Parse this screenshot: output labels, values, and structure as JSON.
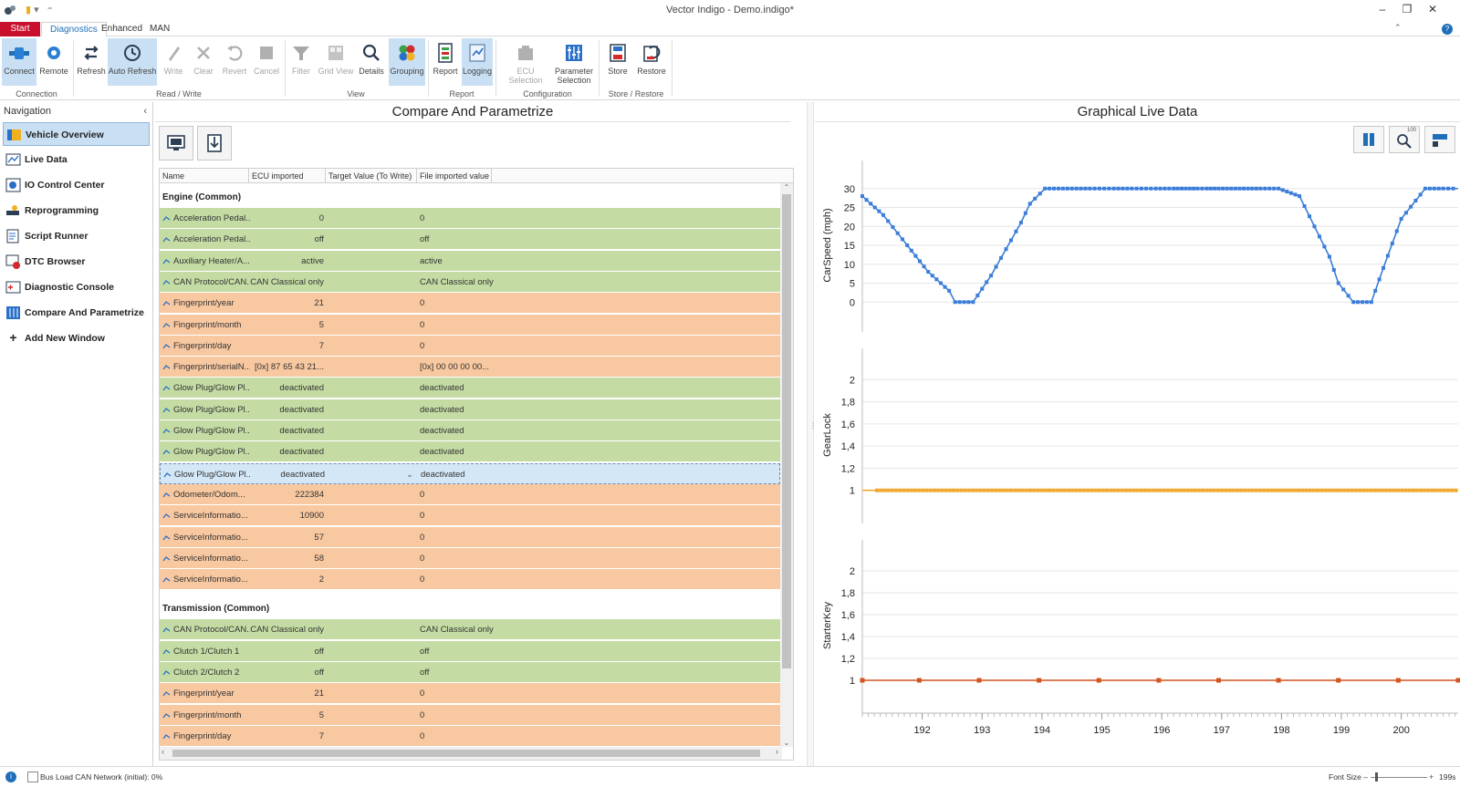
{
  "window": {
    "title": "Vector Indigo - Demo.indigo*",
    "minimize": "–",
    "restore": "❐",
    "close": "✕"
  },
  "ribbon_tabs": [
    {
      "label": "Start"
    },
    {
      "label": "Diagnostics"
    },
    {
      "label": "Enhanced"
    },
    {
      "label": "MAN"
    }
  ],
  "ribbon": {
    "connect": "Connect",
    "remote": "Remote",
    "refresh": "Refresh",
    "auto_refresh": "Auto Refresh",
    "write": "Write",
    "clear": "Clear",
    "revert": "Revert",
    "cancel": "Cancel",
    "filter": "Filter",
    "grid_view": "Grid View",
    "details": "Details",
    "grouping": "Grouping",
    "report": "Report",
    "logging": "Logging",
    "ecu_selection": "ECU Selection",
    "parameter_selection_1": "Parameter",
    "parameter_selection_2": "Selection",
    "store": "Store",
    "restore": "Restore",
    "groups": {
      "connection": "Connection",
      "read_write": "Read / Write",
      "view": "View",
      "report": "Report",
      "configuration": "Configuration",
      "store_restore": "Store / Restore"
    }
  },
  "navigation": {
    "header": "Navigation",
    "items": [
      {
        "label": "Vehicle Overview"
      },
      {
        "label": "Live Data"
      },
      {
        "label": "IO Control Center"
      },
      {
        "label": "Reprogramming"
      },
      {
        "label": "Script Runner"
      },
      {
        "label": "DTC Browser"
      },
      {
        "label": "Diagnostic Console"
      },
      {
        "label": "Compare And Parametrize"
      },
      {
        "label": "Add New Window"
      }
    ]
  },
  "compare": {
    "title": "Compare And Parametrize",
    "columns": [
      "Name",
      "ECU imported value",
      "Target Value (To Write)",
      "File imported value"
    ],
    "groups": [
      {
        "name": "Engine (Common)",
        "rows": [
          {
            "name": "Acceleration Pedal...",
            "ecu": "0",
            "file": "0",
            "color": "green"
          },
          {
            "name": "Acceleration Pedal...",
            "ecu": "off",
            "file": "off",
            "color": "green"
          },
          {
            "name": "Auxiliary Heater/A...",
            "ecu": "active",
            "file": "active",
            "color": "green"
          },
          {
            "name": "CAN Protocol/CAN...",
            "ecu": "CAN Classical only",
            "file": "CAN Classical only",
            "color": "green"
          },
          {
            "name": "Fingerprint/year",
            "ecu": "21",
            "file": "0",
            "color": "orange"
          },
          {
            "name": "Fingerprint/month",
            "ecu": "5",
            "file": "0",
            "color": "orange"
          },
          {
            "name": "Fingerprint/day",
            "ecu": "7",
            "file": "0",
            "color": "orange"
          },
          {
            "name": "Fingerprint/serialN...",
            "ecu": "[0x] 87 65 43 21...",
            "file": "[0x] 00 00 00 00...",
            "color": "orange"
          },
          {
            "name": "Glow Plug/Glow Pl...",
            "ecu": "deactivated",
            "file": "deactivated",
            "color": "green"
          },
          {
            "name": "Glow Plug/Glow Pl...",
            "ecu": "deactivated",
            "file": "deactivated",
            "color": "green"
          },
          {
            "name": "Glow Plug/Glow Pl...",
            "ecu": "deactivated",
            "file": "deactivated",
            "color": "green"
          },
          {
            "name": "Glow Plug/Glow Pl...",
            "ecu": "deactivated",
            "file": "deactivated",
            "color": "green"
          },
          {
            "name": "Glow Plug/Glow Pl...",
            "ecu": "deactivated",
            "file": "deactivated",
            "color": "sel"
          },
          {
            "name": "Odometer/Odom...",
            "ecu": "222384",
            "file": "0",
            "color": "orange"
          },
          {
            "name": "ServiceInformatio...",
            "ecu": "10900",
            "file": "0",
            "color": "orange"
          },
          {
            "name": "ServiceInformatio...",
            "ecu": "57",
            "file": "0",
            "color": "orange"
          },
          {
            "name": "ServiceInformatio...",
            "ecu": "58",
            "file": "0",
            "color": "orange"
          },
          {
            "name": "ServiceInformatio...",
            "ecu": "2",
            "file": "0",
            "color": "orange"
          }
        ]
      },
      {
        "name": "Transmission (Common)",
        "rows": [
          {
            "name": "CAN Protocol/CAN...",
            "ecu": "CAN Classical only",
            "file": "CAN Classical only",
            "color": "green"
          },
          {
            "name": "Clutch 1/Clutch 1",
            "ecu": "off",
            "file": "off",
            "color": "green"
          },
          {
            "name": "Clutch 2/Clutch 2",
            "ecu": "off",
            "file": "off",
            "color": "green"
          },
          {
            "name": "Fingerprint/year",
            "ecu": "21",
            "file": "0",
            "color": "orange"
          },
          {
            "name": "Fingerprint/month",
            "ecu": "5",
            "file": "0",
            "color": "orange"
          },
          {
            "name": "Fingerprint/day",
            "ecu": "7",
            "file": "0",
            "color": "orange"
          }
        ]
      }
    ],
    "colors": {
      "green": "#c4dca4",
      "orange": "#f8c8a0",
      "selected": "#d4e7f7"
    }
  },
  "graph": {
    "title": "Graphical Live Data",
    "buttons": [
      "pause-icon",
      "zoom-icon",
      "settings-icon"
    ],
    "zoom_badge": "100"
  },
  "chart_data": [
    {
      "type": "line",
      "ylabel": "CarSpeed (mph)",
      "yticks": [
        0,
        5,
        10,
        15,
        20,
        25,
        30
      ],
      "ylim": [
        -5,
        35
      ],
      "xlim": [
        191.0,
        200.95
      ],
      "color": "#3b7dd8",
      "x": [
        191.0,
        191.35,
        191.75,
        192.1,
        192.45,
        192.55,
        192.85,
        193.15,
        193.4,
        193.65,
        193.8,
        194.05,
        194.5,
        194.8,
        195.2,
        195.5,
        195.9,
        196.2,
        196.4,
        196.6,
        196.75,
        196.95,
        197.3,
        197.65,
        197.95,
        198.3,
        198.55,
        198.8,
        198.95,
        199.2,
        199.5,
        199.7,
        200.0,
        200.4,
        200.7,
        200.95
      ],
      "y": [
        28,
        23,
        15,
        8,
        3,
        0,
        0,
        7,
        14,
        21,
        26,
        30,
        30,
        30,
        30,
        30,
        30,
        30,
        30,
        30,
        30,
        30,
        30,
        30,
        30,
        28,
        20,
        12,
        5,
        0,
        0,
        9,
        22,
        30,
        30,
        30
      ]
    },
    {
      "type": "line",
      "ylabel": "GearLock",
      "yticks": [
        1,
        1.2,
        1.4,
        1.6,
        1.8,
        2
      ],
      "ylim": [
        0.8,
        2.2
      ],
      "xlim": [
        191.0,
        200.95
      ],
      "color": "#f0a830",
      "x": [
        191.0,
        200.95
      ],
      "y": [
        1,
        1
      ]
    },
    {
      "type": "line",
      "ylabel": "StarterKey",
      "yticks": [
        1,
        1.2,
        1.4,
        1.6,
        1.8,
        2
      ],
      "ylim": [
        0.8,
        2.2
      ],
      "xlim": [
        191.0,
        200.95
      ],
      "color": "#d2541e",
      "x": [
        191.0,
        191.95,
        192.95,
        193.95,
        194.95,
        195.95,
        196.95,
        197.95,
        198.95,
        199.95,
        200.95
      ],
      "y": [
        1,
        1,
        1,
        1,
        1,
        1,
        1,
        1,
        1,
        1,
        1
      ],
      "xticks": [
        192,
        193,
        194,
        195,
        196,
        197,
        198,
        199,
        200
      ]
    }
  ],
  "statusbar": {
    "bus_load": "Bus Load CAN Network (initial): 0%",
    "font_size": "Font Size",
    "zoom_value": "199s"
  }
}
